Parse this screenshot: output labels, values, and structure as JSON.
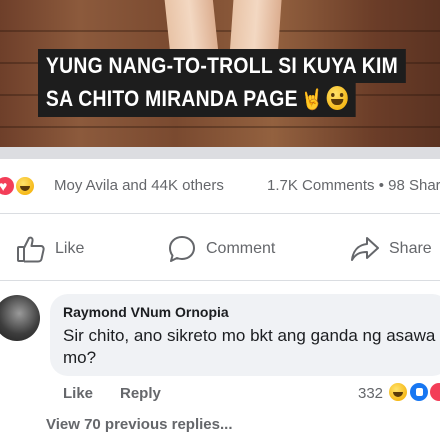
{
  "post": {
    "caption_line1": "YUNG NANG-TO-TROLL SI KUYA KIM",
    "caption_line2": "SA CHITO MIRANDA PAGE",
    "caption_emojis": [
      "rock-hand-emoji",
      "laughing-sweat-emoji"
    ]
  },
  "reactions_summary": {
    "icons": [
      "love-reaction-icon",
      "haha-reaction-icon"
    ],
    "people_text": "Moy Avila and 44K others",
    "stats_text": "1.7K Comments • 98 Shar"
  },
  "actions": {
    "like": "Like",
    "comment": "Comment",
    "share": "Share"
  },
  "comment": {
    "author": "Raymond VNum Ornopia",
    "text": "Sir chito, ano sikreto mo bkt ang ganda ng asawa mo?",
    "like_label": "Like",
    "reply_label": "Reply",
    "reaction_count": "332",
    "reaction_icons": [
      "haha-reaction-icon",
      "like-reaction-icon",
      "love-reaction-icon"
    ],
    "view_replies": "View 70 previous replies..."
  },
  "colors": {
    "facebook_blue": "#1877f2",
    "love_red": "#f33e58",
    "muted_text": "#65676b",
    "bubble_bg": "#f0f2f5"
  }
}
